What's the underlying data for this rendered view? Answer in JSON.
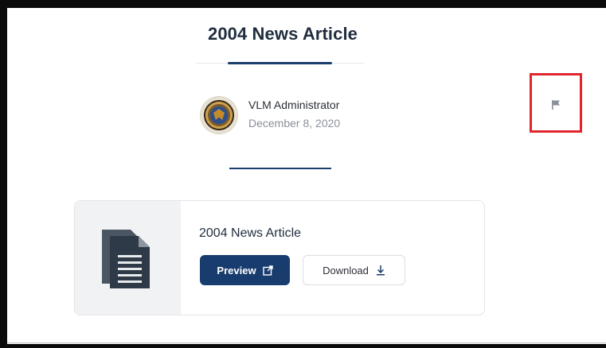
{
  "article": {
    "title": "2004 News Article"
  },
  "author": {
    "name": "VLM Administrator",
    "date": "December 8, 2020",
    "avatar_icon": "seal-avatar-icon"
  },
  "actions": {
    "flag_icon": "flag-icon",
    "highlight_color": "#e0262c"
  },
  "attachment": {
    "title": "2004 News Article",
    "icon": "document-icon",
    "preview_label": "Preview",
    "preview_icon": "external-link-icon",
    "download_label": "Download",
    "download_icon": "download-icon"
  },
  "colors": {
    "primary": "#183c6e",
    "text": "#1f2d3d",
    "muted": "#8a9099"
  }
}
